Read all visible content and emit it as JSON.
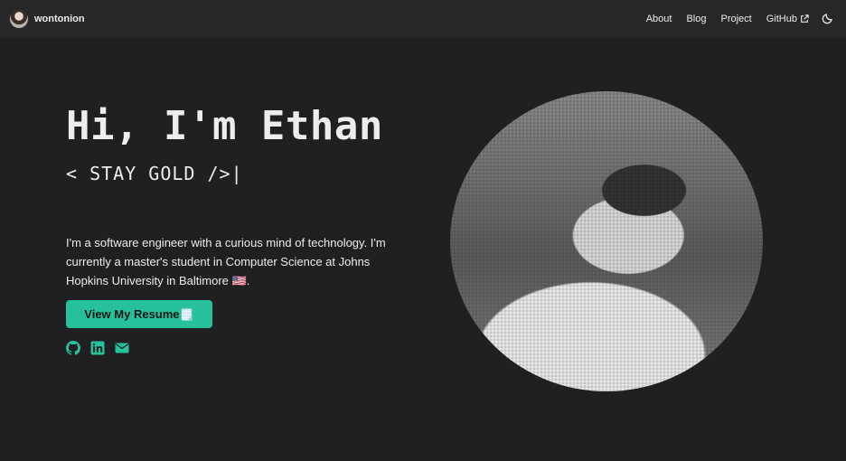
{
  "nav": {
    "brand": "wontonion",
    "links": [
      {
        "label": "About"
      },
      {
        "label": "Blog"
      },
      {
        "label": "Project"
      },
      {
        "label": "GitHub"
      }
    ]
  },
  "hero": {
    "title": "Hi, I'm Ethan",
    "tagline": "< STAY GOLD />|",
    "bio": "I'm a software engineer with a curious mind of technology. I'm currently a master's student in Computer Science at Johns Hopkins University in Baltimore 🇺🇸.",
    "resume_button": "View My Resume🗒️"
  },
  "colors": {
    "accent": "#26c09a",
    "background": "#202023",
    "navbar": "#28282b"
  },
  "icons": [
    "github-icon",
    "linkedin-icon",
    "mail-icon",
    "external-link-icon",
    "moon-icon"
  ]
}
